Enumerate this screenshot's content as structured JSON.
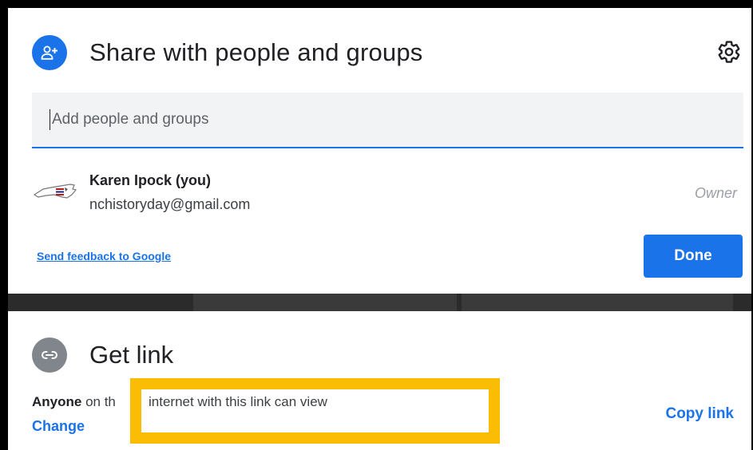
{
  "share_dialog": {
    "title": "Share with people and groups",
    "header_icon": "person-add-icon",
    "settings_icon": "gear-icon",
    "add_field": {
      "placeholder": "Add people and groups",
      "value": ""
    },
    "people": [
      {
        "name": "Karen Ipock (you)",
        "email": "nchistoryday@gmail.com",
        "role": "Owner",
        "avatar_icon": "north-carolina-state-icon"
      }
    ],
    "feedback_link": "Send feedback to Google",
    "done_button": "Done"
  },
  "get_link": {
    "title": "Get link",
    "header_icon": "link-icon",
    "description_who": "Anyone",
    "description_visible": " on th",
    "description_highlighted": "internet with this link can view",
    "change_link": "Change",
    "copy_link": "Copy link"
  },
  "colors": {
    "accent": "#1a73e8",
    "highlight": "#fbbc04",
    "link_icon_bg": "#80868b",
    "role_text": "#9aa0a6"
  }
}
